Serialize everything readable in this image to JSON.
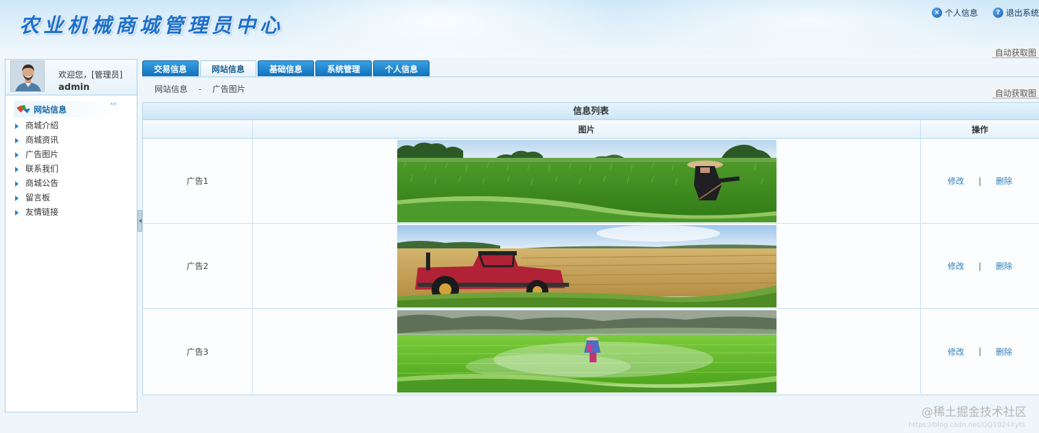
{
  "header": {
    "title": "农业机械商城管理员中心",
    "links": [
      {
        "icon": "info-x-icon",
        "glyph": "×",
        "label": "个人信息"
      },
      {
        "icon": "help-question-icon",
        "glyph": "?",
        "label": "退出系统"
      }
    ],
    "auto_fetch_label": "自动获取图"
  },
  "sidebar": {
    "welcome": "欢迎您，[管理员]",
    "username": "admin",
    "section_title": "网站信息",
    "items": [
      {
        "label": "商城介绍"
      },
      {
        "label": "商城资讯"
      },
      {
        "label": "广告图片"
      },
      {
        "label": "联系我们"
      },
      {
        "label": "商城公告"
      },
      {
        "label": "留言板"
      },
      {
        "label": "友情链接"
      }
    ]
  },
  "tabs": [
    {
      "label": "交易信息",
      "active": false
    },
    {
      "label": "网站信息",
      "active": true
    },
    {
      "label": "基础信息",
      "active": false
    },
    {
      "label": "系统管理",
      "active": false
    },
    {
      "label": "个人信息",
      "active": false
    }
  ],
  "breadcrumb": {
    "parent": "网站信息",
    "separator": "-",
    "current": "广告图片"
  },
  "table": {
    "caption": "信息列表",
    "columns": [
      "",
      "图片",
      "操作"
    ],
    "rows": [
      {
        "name": "广告1",
        "image": "farmer-in-rice-field",
        "edit": "修改",
        "sep": "|",
        "delete": "删除"
      },
      {
        "name": "广告2",
        "image": "red-tractor-harvest-field",
        "edit": "修改",
        "sep": "|",
        "delete": "删除"
      },
      {
        "name": "广告3",
        "image": "drone-spraying-green-field",
        "edit": "修改",
        "sep": "|",
        "delete": "删除"
      }
    ]
  },
  "watermark": {
    "text": "@稀土掘金技术社区",
    "url": "https://blog.csdn.net/QQ1024Xyts"
  },
  "colors": {
    "tab_blue": "#1a7bc4",
    "link": "#2f7fb8",
    "title_blue": "#1c6fc9"
  }
}
